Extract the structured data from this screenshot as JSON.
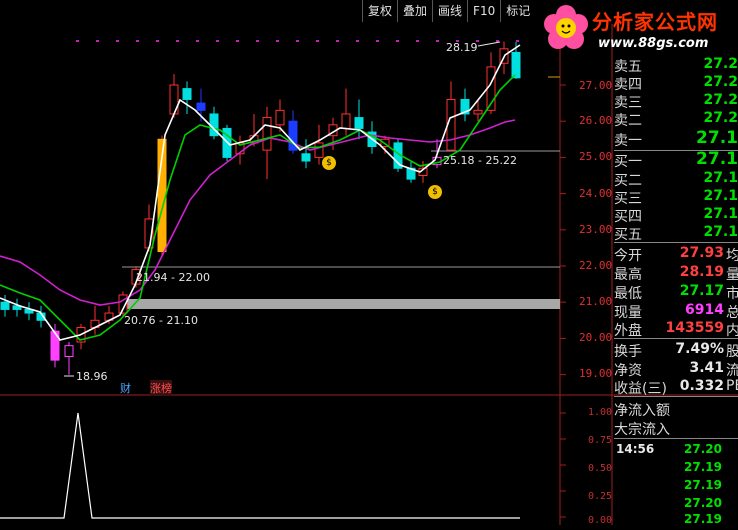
{
  "toolbar": {
    "buttons": [
      "复权",
      "叠加",
      "画线",
      "F10",
      "标记"
    ]
  },
  "logo": {
    "title": "分析家公式网",
    "url": "www.88gs.com"
  },
  "price_axis": [
    "27.00",
    "26.00",
    "25.00",
    "24.00",
    "23.00",
    "22.00",
    "21.00",
    "20.00",
    "19.00"
  ],
  "indicator_axis": [
    "1.00",
    "0.75",
    "0.50",
    "0.25",
    "0.00"
  ],
  "annotations": {
    "high": "28.19",
    "low": "18.96",
    "range1": "21.94 - 22.00",
    "range2": "20.76 - 21.10",
    "range3": "25.18 - 25.22",
    "tag_cai": "财",
    "tag_zhang": "涨榜"
  },
  "order_book": {
    "asks": [
      {
        "label": "卖五",
        "price": "27.2"
      },
      {
        "label": "卖四",
        "price": "27.2"
      },
      {
        "label": "卖三",
        "price": "27.2"
      },
      {
        "label": "卖二",
        "price": "27.2"
      },
      {
        "label": "卖一",
        "price": "27.1"
      }
    ],
    "bids": [
      {
        "label": "买一",
        "price": "27.1"
      },
      {
        "label": "买二",
        "price": "27.1"
      },
      {
        "label": "买三",
        "price": "27.1"
      },
      {
        "label": "买四",
        "price": "27.1"
      },
      {
        "label": "买五",
        "price": "27.1"
      }
    ]
  },
  "quote": [
    {
      "label": "今开",
      "value": "27.93",
      "color": "#ff4040",
      "extra": "均"
    },
    {
      "label": "最高",
      "value": "28.19",
      "color": "#ff4040",
      "extra": "量"
    },
    {
      "label": "最低",
      "value": "27.17",
      "color": "#00e0e0",
      "extra": "市"
    },
    {
      "label": "现量",
      "value": "6914",
      "color": "#ff40ff",
      "extra": "总"
    },
    {
      "label": "外盘",
      "value": "143559",
      "color": "#ff4040",
      "extra": "内"
    }
  ],
  "stats": [
    {
      "label": "换手",
      "value": "7.49%",
      "extra": "股"
    },
    {
      "label": "净资",
      "value": "3.41",
      "extra": "流"
    },
    {
      "label": "收益(三)",
      "value": "0.332",
      "extra": "PE"
    }
  ],
  "flow": {
    "line1": "净流入额",
    "line2": "大宗流入"
  },
  "ticks": [
    {
      "time": "14:56",
      "price": "27.20"
    },
    {
      "time": "",
      "price": "27.19"
    },
    {
      "time": "",
      "price": "27.19"
    },
    {
      "time": "",
      "price": "27.20"
    },
    {
      "time": "",
      "price": "27.19"
    }
  ],
  "colors": {
    "up": "#ff3030",
    "down": "#00e0e0",
    "bid": "#00e000",
    "ma5": "#ffffff",
    "ma10": "#00d000",
    "ma20": "#d020d0"
  }
}
